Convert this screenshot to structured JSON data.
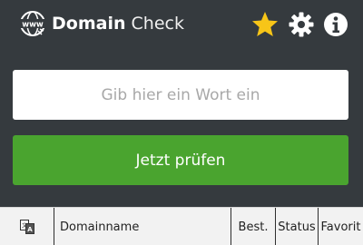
{
  "header": {
    "title_bold": "Domain",
    "title_light": " Check",
    "logo_icon": "www-globe-icon",
    "favorites_icon": "star-icon",
    "settings_icon": "gear-icon",
    "info_icon": "info-icon"
  },
  "search": {
    "placeholder": "Gib hier ein Wort ein",
    "value": ""
  },
  "check_button": {
    "label": "Jetzt prüfen"
  },
  "table": {
    "columns": {
      "language_icon": "translate-icon",
      "domainname": "Domainname",
      "best": "Best.",
      "status": "Status",
      "favorit": "Favorit"
    }
  },
  "colors": {
    "background": "#353a3e",
    "accent_green": "#4aa42f",
    "star_yellow": "#f7c518"
  }
}
